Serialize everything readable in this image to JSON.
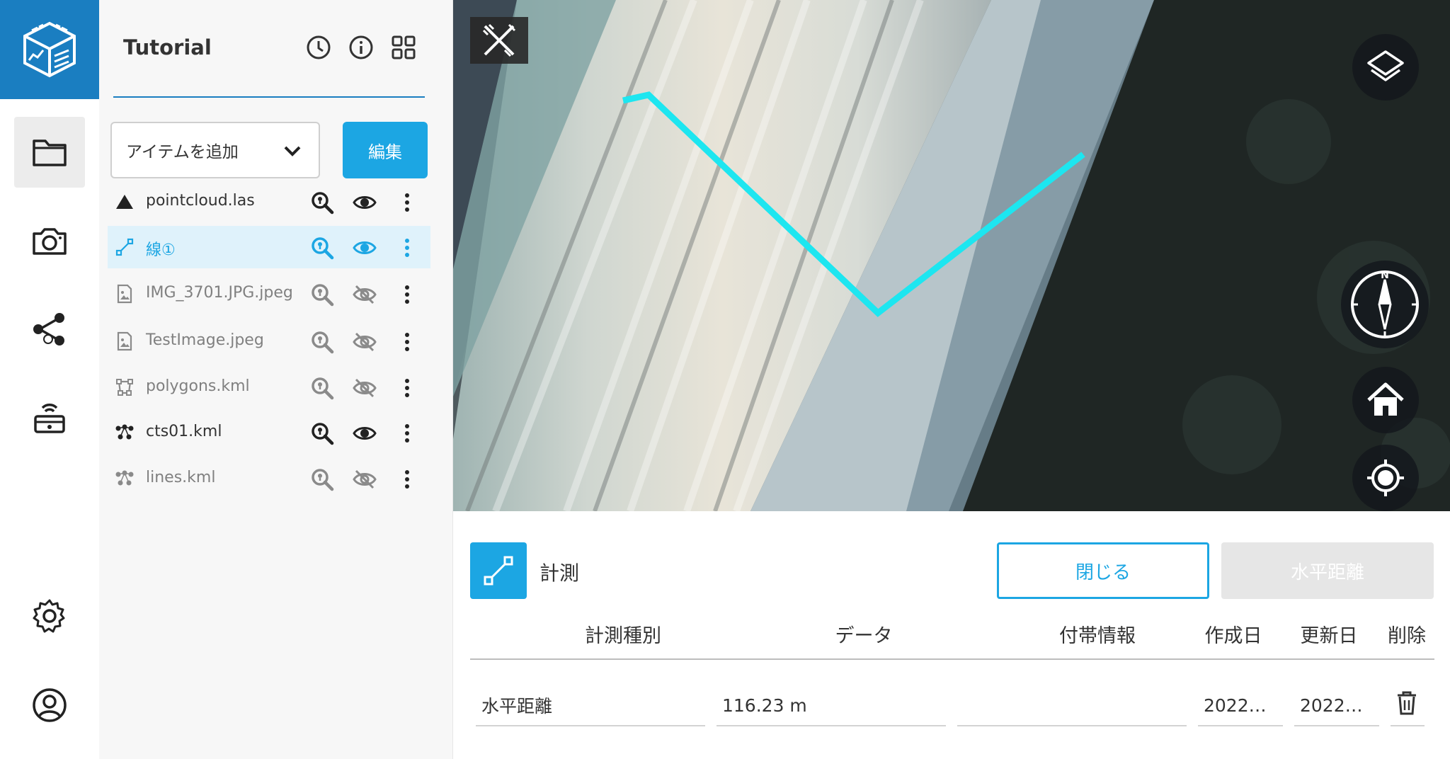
{
  "app": {
    "project_title": "Tutorial"
  },
  "panel": {
    "add_item_label": "アイテムを追加",
    "edit_label": "編集",
    "layers": [
      {
        "name": "pointcloud.las",
        "type": "pointcloud-icon",
        "visible": true,
        "dim": false,
        "selected": false
      },
      {
        "name": "線①",
        "type": "line-icon",
        "visible": true,
        "dim": false,
        "selected": true
      },
      {
        "name": "IMG_3701.JPG.jpeg",
        "type": "image-icon",
        "visible": false,
        "dim": true,
        "selected": false
      },
      {
        "name": "TestImage.jpeg",
        "type": "image-icon",
        "visible": false,
        "dim": true,
        "selected": false
      },
      {
        "name": "polygons.kml",
        "type": "polygon-icon",
        "visible": false,
        "dim": true,
        "selected": false
      },
      {
        "name": "cts01.kml",
        "type": "points-icon",
        "visible": true,
        "dim": false,
        "selected": false
      },
      {
        "name": "lines.kml",
        "type": "points-icon",
        "visible": false,
        "dim": true,
        "selected": false
      }
    ]
  },
  "measure": {
    "title": "計測",
    "close_label": "閉じる",
    "type_label": "水平距離",
    "columns": [
      "計測種別",
      "データ",
      "付帯情報",
      "作成日",
      "更新日",
      "削除"
    ],
    "row": {
      "type": "水平距離",
      "data": "116.23 m",
      "info": "",
      "created": "2022…",
      "updated": "2022…"
    }
  },
  "colors": {
    "brand": "#1a7ec1",
    "accent": "#1ca6e3",
    "measure_line": "#1de6f0"
  }
}
